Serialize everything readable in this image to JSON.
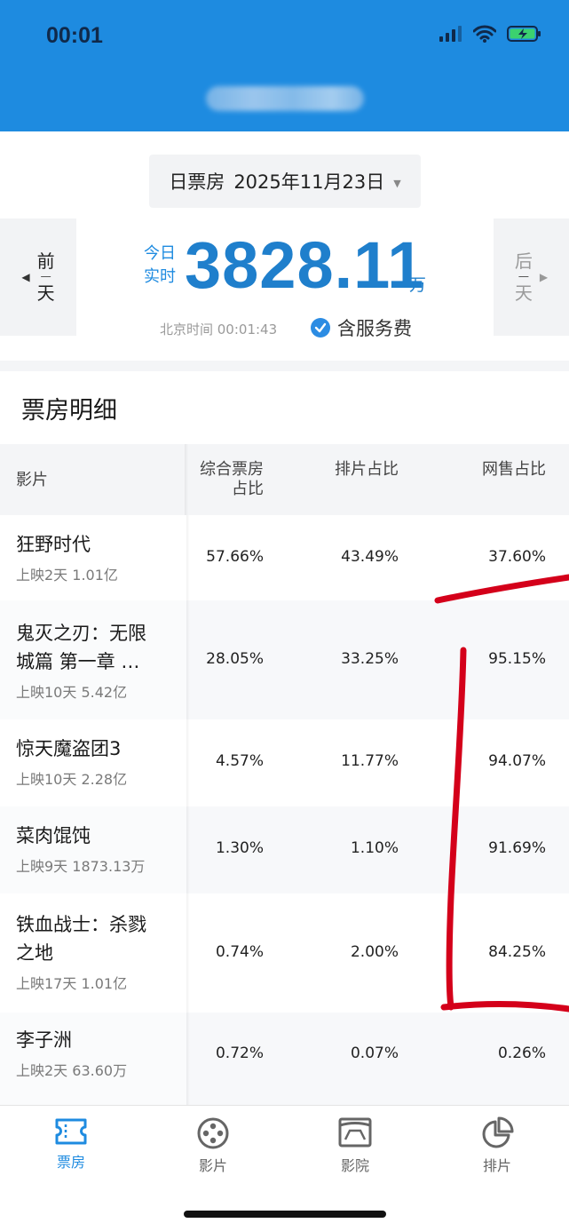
{
  "status_bar": {
    "time": "00:01"
  },
  "header": {
    "title_blurred": ""
  },
  "date_selector": {
    "label": "日票房",
    "date": "2025年11月23日"
  },
  "nav": {
    "prev_top": "前",
    "prev_bottom": "天",
    "next_top": "后",
    "next_bottom": "天"
  },
  "box_office": {
    "label_line1": "今日",
    "label_line2": "实时",
    "value": "3828.11",
    "unit": "万",
    "beijing_time": "北京时间 00:01:43",
    "service_fee": "含服务费"
  },
  "details": {
    "title": "票房明细",
    "columns": {
      "film": "影片",
      "box_share_line1": "综合票房",
      "box_share_line2": "占比",
      "screening_share": "排片占比",
      "online_share": "网售占比"
    },
    "rows": [
      {
        "name_line1": "狂野时代",
        "name_line2": "",
        "sub": "上映2天 1.01亿",
        "box_share": "57.66%",
        "screening_share": "43.49%",
        "online_share": "37.60%"
      },
      {
        "name_line1": "鬼灭之刃：无限",
        "name_line2": "城篇 第一章 …",
        "sub": "上映10天 5.42亿",
        "box_share": "28.05%",
        "screening_share": "33.25%",
        "online_share": "95.15%"
      },
      {
        "name_line1": "惊天魔盗团3",
        "name_line2": "",
        "sub": "上映10天 2.28亿",
        "box_share": "4.57%",
        "screening_share": "11.77%",
        "online_share": "94.07%"
      },
      {
        "name_line1": "菜肉馄饨",
        "name_line2": "",
        "sub": "上映9天 1873.13万",
        "box_share": "1.30%",
        "screening_share": "1.10%",
        "online_share": "91.69%"
      },
      {
        "name_line1": "铁血战士：杀戮",
        "name_line2": "之地",
        "sub": "上映17天 1.01亿",
        "box_share": "0.74%",
        "screening_share": "2.00%",
        "online_share": "84.25%"
      },
      {
        "name_line1": "李子洲",
        "name_line2": "",
        "sub": "上映2天 63.60万",
        "box_share": "0.72%",
        "screening_share": "0.07%",
        "online_share": "0.26%"
      }
    ]
  },
  "tabs": [
    {
      "label": "票房",
      "icon": "ticket-icon",
      "active": true
    },
    {
      "label": "影片",
      "icon": "film-reel-icon",
      "active": false
    },
    {
      "label": "影院",
      "icon": "cinema-screen-icon",
      "active": false
    },
    {
      "label": "排片",
      "icon": "pie-chart-icon",
      "active": false
    }
  ],
  "colors": {
    "header_blue": "#1e8be0",
    "number_blue": "#1f7fcc",
    "annotation_red": "#d4001a"
  }
}
